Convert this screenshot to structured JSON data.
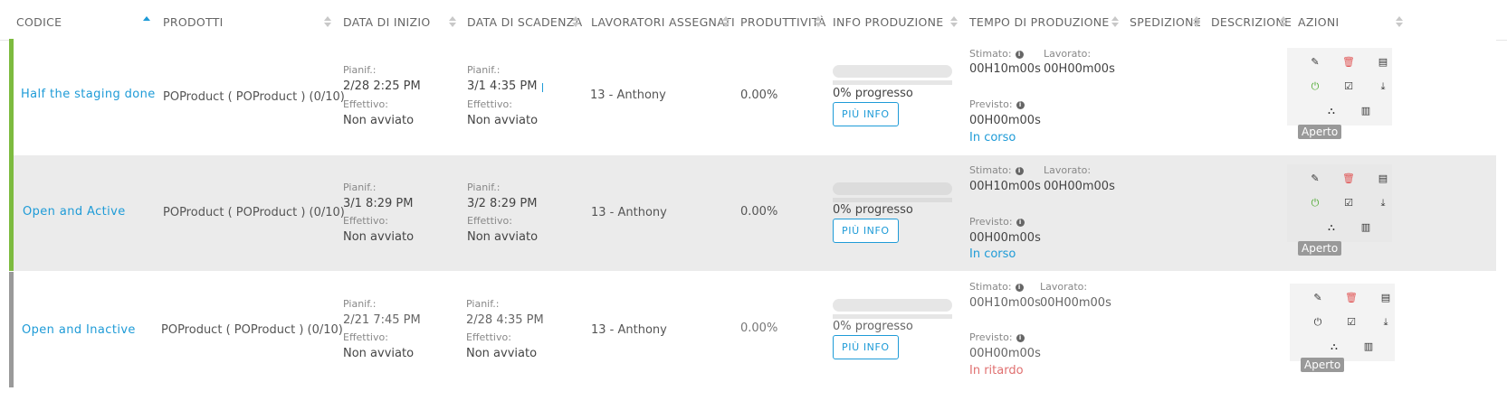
{
  "colors": {
    "accent": "#1e9bd7",
    "active_bar": "#7dbb3f",
    "inactive_bar": "#9a9a9a",
    "alt_row": "#ebebeb",
    "late": "#e07070"
  },
  "headers": {
    "codice": "CODICE",
    "prodotti": "PRODOTTI",
    "data_inizio": "DATA DI INIZIO",
    "data_scadenza": "DATA DI SCADENZA",
    "lavoratori": "LAVORATORI ASSEGNATI",
    "produttivita": "PRODUTTIVITÀ",
    "info_produzione": "INFO PRODUZIONE",
    "tempo_produzione": "TEMPO DI PRODUZIONE",
    "spedizione": "SPEDIZIONE",
    "descrizione": "DESCRIZIONE",
    "azioni": "AZIONI"
  },
  "labels": {
    "pianif": "Pianif.:",
    "effettivo": "Effettivo:",
    "stimato": "Stimato:",
    "lavorato": "Lavorato:",
    "previsto": "Previsto:",
    "piu_info": "PIÙ INFO"
  },
  "rows": [
    {
      "code": "Half the staging done",
      "product": "POProduct ( POProduct ) (0/10)",
      "start_planned": "2/28   2:25 PM",
      "start_actual": "Non avviato",
      "due_planned": "3/1   4:35 PM",
      "due_actual": "Non avviato",
      "worker": "13 - Anthony",
      "productivity": "0.00%",
      "progress": 0,
      "progress_label": "0% progresso",
      "estimated": "00H10m00s",
      "worked": "00H00m00s",
      "forecast": "00H00m00s",
      "status": "In corso",
      "badge": "Aperto",
      "state": "active"
    },
    {
      "code": "Open and Active",
      "product": "POProduct ( POProduct ) (0/10)",
      "start_planned": "3/1   8:29 PM",
      "start_actual": "Non avviato",
      "due_planned": "3/2   8:29 PM",
      "due_actual": "Non avviato",
      "worker": "13 - Anthony",
      "productivity": "0.00%",
      "progress": 0,
      "progress_label": "0% progresso",
      "estimated": "00H10m00s",
      "worked": "00H00m00s",
      "forecast": "00H00m00s",
      "status": "In corso",
      "badge": "Aperto",
      "state": "active"
    },
    {
      "code": "Open and Inactive",
      "product": "POProduct ( POProduct ) (0/10)",
      "start_planned": "2/21   7:45 PM",
      "start_actual": "Non avviato",
      "due_planned": "2/28   4:35 PM",
      "due_actual": "Non avviato",
      "worker": "13 - Anthony",
      "productivity": "0.00%",
      "progress": 0,
      "progress_label": "0% progresso",
      "estimated": "00H10m00s",
      "worked": "00H00m00s",
      "forecast": "00H00m00s",
      "status": "In ritardo",
      "badge": "Aperto",
      "state": "inactive"
    }
  ],
  "action_icons": [
    "edit-icon",
    "delete-icon",
    "document-icon",
    "power-icon",
    "checklist-icon",
    "download-icon",
    "hierarchy-icon",
    "barcode-icon"
  ]
}
